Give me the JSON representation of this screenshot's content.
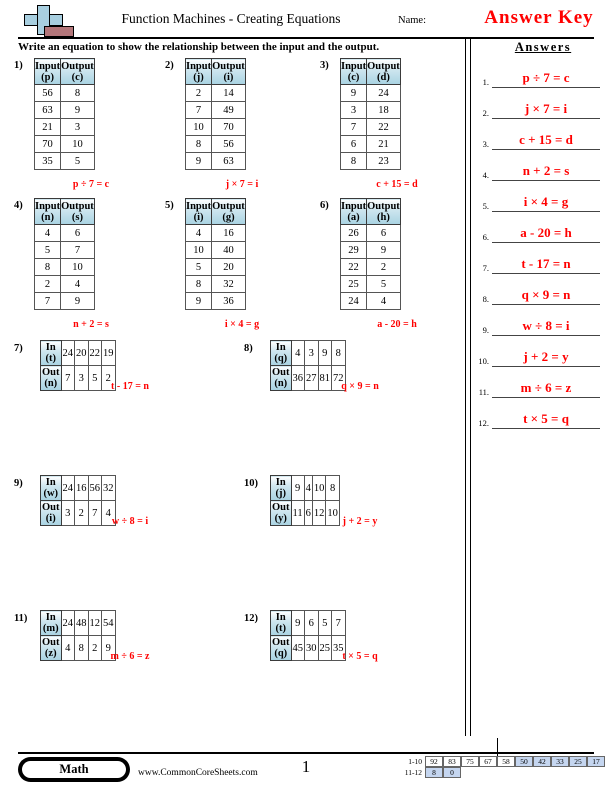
{
  "header": {
    "title": "Function Machines - Creating Equations",
    "name_label": "Name:",
    "answer_key_label": "Answer Key",
    "instructions": "Write an equation to show the relationship between the input and the output.",
    "logo": "commoncoresheets-plus-logo"
  },
  "answers_panel": {
    "title": "Answers",
    "items": [
      {
        "num": "1.",
        "text": "p ÷ 7 = c"
      },
      {
        "num": "2.",
        "text": "j × 7 = i"
      },
      {
        "num": "3.",
        "text": "c + 15 = d"
      },
      {
        "num": "4.",
        "text": "n + 2 = s"
      },
      {
        "num": "5.",
        "text": "i × 4 = g"
      },
      {
        "num": "6.",
        "text": "a - 20 = h"
      },
      {
        "num": "7.",
        "text": "t - 17 = n"
      },
      {
        "num": "8.",
        "text": "q × 9 = n"
      },
      {
        "num": "9.",
        "text": "w ÷ 8 = i"
      },
      {
        "num": "10.",
        "text": "j + 2 = y"
      },
      {
        "num": "11.",
        "text": "m ÷ 6 = z"
      },
      {
        "num": "12.",
        "text": "t × 5 = q"
      }
    ]
  },
  "vertical_problems": [
    {
      "num": "1)",
      "input_header": "Input",
      "input_var": "(p)",
      "output_header": "Output",
      "output_var": "(c)",
      "rows": [
        [
          "56",
          "8"
        ],
        [
          "63",
          "9"
        ],
        [
          "21",
          "3"
        ],
        [
          "70",
          "10"
        ],
        [
          "35",
          "5"
        ]
      ],
      "equation": "p ÷ 7 = c"
    },
    {
      "num": "2)",
      "input_header": "Input",
      "input_var": "(j)",
      "output_header": "Output",
      "output_var": "(i)",
      "rows": [
        [
          "2",
          "14"
        ],
        [
          "7",
          "49"
        ],
        [
          "10",
          "70"
        ],
        [
          "8",
          "56"
        ],
        [
          "9",
          "63"
        ]
      ],
      "equation": "j × 7 = i"
    },
    {
      "num": "3)",
      "input_header": "Input",
      "input_var": "(c)",
      "output_header": "Output",
      "output_var": "(d)",
      "rows": [
        [
          "9",
          "24"
        ],
        [
          "3",
          "18"
        ],
        [
          "7",
          "22"
        ],
        [
          "6",
          "21"
        ],
        [
          "8",
          "23"
        ]
      ],
      "equation": "c + 15 = d"
    },
    {
      "num": "4)",
      "input_header": "Input",
      "input_var": "(n)",
      "output_header": "Output",
      "output_var": "(s)",
      "rows": [
        [
          "4",
          "6"
        ],
        [
          "5",
          "7"
        ],
        [
          "8",
          "10"
        ],
        [
          "2",
          "4"
        ],
        [
          "7",
          "9"
        ]
      ],
      "equation": "n + 2 = s"
    },
    {
      "num": "5)",
      "input_header": "Input",
      "input_var": "(i)",
      "output_header": "Output",
      "output_var": "(g)",
      "rows": [
        [
          "4",
          "16"
        ],
        [
          "10",
          "40"
        ],
        [
          "5",
          "20"
        ],
        [
          "8",
          "32"
        ],
        [
          "9",
          "36"
        ]
      ],
      "equation": "i × 4 = g"
    },
    {
      "num": "6)",
      "input_header": "Input",
      "input_var": "(a)",
      "output_header": "Output",
      "output_var": "(h)",
      "rows": [
        [
          "26",
          "6"
        ],
        [
          "29",
          "9"
        ],
        [
          "22",
          "2"
        ],
        [
          "25",
          "5"
        ],
        [
          "24",
          "4"
        ]
      ],
      "equation": "a - 20 = h"
    }
  ],
  "horizontal_problems": [
    {
      "num": "7)",
      "in_label": "In (t)",
      "out_label": "Out (n)",
      "in_values": [
        "24",
        "20",
        "22",
        "19"
      ],
      "out_values": [
        "7",
        "3",
        "5",
        "2"
      ],
      "equation": "t - 17 = n"
    },
    {
      "num": "8)",
      "in_label": "In (q)",
      "out_label": "Out (n)",
      "in_values": [
        "4",
        "3",
        "9",
        "8"
      ],
      "out_values": [
        "36",
        "27",
        "81",
        "72"
      ],
      "equation": "q × 9 = n"
    },
    {
      "num": "9)",
      "in_label": "In (w)",
      "out_label": "Out (i)",
      "in_values": [
        "24",
        "16",
        "56",
        "32"
      ],
      "out_values": [
        "3",
        "2",
        "7",
        "4"
      ],
      "equation": "w ÷ 8 = i"
    },
    {
      "num": "10)",
      "in_label": "In (j)",
      "out_label": "Out (y)",
      "in_values": [
        "9",
        "4",
        "10",
        "8"
      ],
      "out_values": [
        "11",
        "6",
        "12",
        "10"
      ],
      "equation": "j + 2 = y"
    },
    {
      "num": "11)",
      "in_label": "In (m)",
      "out_label": "Out (z)",
      "in_values": [
        "24",
        "48",
        "12",
        "54"
      ],
      "out_values": [
        "4",
        "8",
        "2",
        "9"
      ],
      "equation": "m ÷ 6 = z"
    },
    {
      "num": "12)",
      "in_label": "In (t)",
      "out_label": "Out (q)",
      "in_values": [
        "9",
        "6",
        "5",
        "7"
      ],
      "out_values": [
        "45",
        "30",
        "25",
        "35"
      ],
      "equation": "t × 5 = q"
    }
  ],
  "footer": {
    "subject": "Math",
    "url": "www.CommonCoreSheets.com",
    "page_number": "1",
    "score_rows": [
      {
        "label": "1-10",
        "cells": [
          {
            "value": "92",
            "shaded": false
          },
          {
            "value": "83",
            "shaded": false
          },
          {
            "value": "75",
            "shaded": false
          },
          {
            "value": "67",
            "shaded": false
          },
          {
            "value": "58",
            "shaded": false
          },
          {
            "value": "50",
            "shaded": true
          },
          {
            "value": "42",
            "shaded": true
          },
          {
            "value": "33",
            "shaded": true
          },
          {
            "value": "25",
            "shaded": true
          },
          {
            "value": "17",
            "shaded": true
          }
        ]
      },
      {
        "label": "11-12",
        "cells": [
          {
            "value": "8",
            "shaded": true
          },
          {
            "value": "0",
            "shaded": true
          }
        ]
      }
    ]
  },
  "colors": {
    "answer_red": "#ff0000",
    "header_blue": "#a9d3e2",
    "score_shade": "#c5d6f0",
    "logo_blue": "#a8cfe0",
    "logo_red": "#b3767a"
  }
}
